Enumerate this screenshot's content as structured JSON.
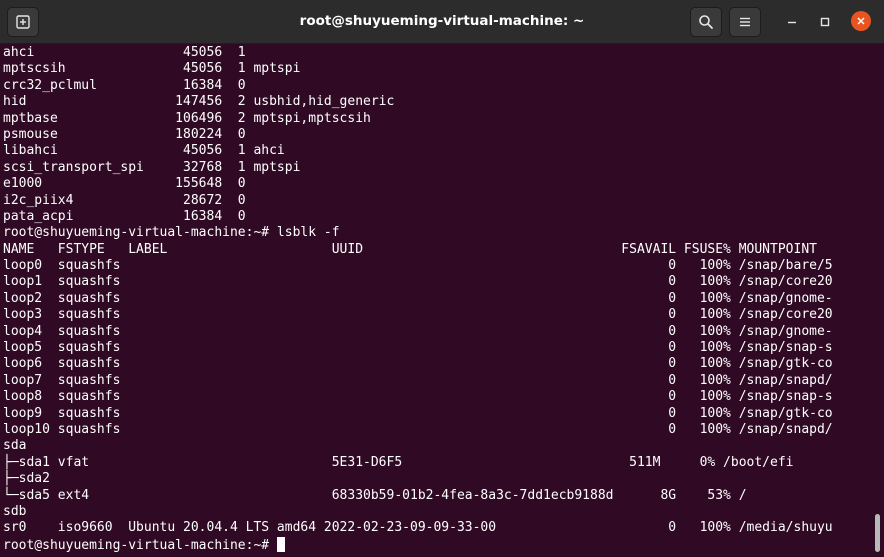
{
  "window": {
    "title": "root@shuyueming-virtual-machine: ~"
  },
  "icons": {
    "new_tab": "new-tab-icon",
    "search": "search-icon",
    "menu": "hamburger-menu-icon",
    "minimize": "minimize-icon",
    "maximize": "maximize-icon",
    "close": "close-icon"
  },
  "colors": {
    "terminal_background": "#300a24",
    "titlebar_background": "#2c2c2c",
    "close_button": "#e95420",
    "text": "#ffffff"
  },
  "terminal": {
    "lines": [
      "ahci                   45056  1",
      "mptscsih               45056  1 mptspi",
      "crc32_pclmul           16384  0",
      "hid                   147456  2 usbhid,hid_generic",
      "mptbase               106496  2 mptspi,mptscsih",
      "psmouse               180224  0",
      "libahci                45056  1 ahci",
      "scsi_transport_spi     32768  1 mptspi",
      "e1000                 155648  0",
      "i2c_piix4              28672  0",
      "pata_acpi              16384  0",
      "root@shuyueming-virtual-machine:~# lsblk -f",
      "NAME   FSTYPE   LABEL                     UUID                                 FSAVAIL FSUSE% MOUNTPOINT",
      "loop0  squashfs                                                                      0   100% /snap/bare/5",
      "loop1  squashfs                                                                      0   100% /snap/core20",
      "loop2  squashfs                                                                      0   100% /snap/gnome-",
      "loop3  squashfs                                                                      0   100% /snap/core20",
      "loop4  squashfs                                                                      0   100% /snap/gnome-",
      "loop5  squashfs                                                                      0   100% /snap/snap-s",
      "loop6  squashfs                                                                      0   100% /snap/gtk-co",
      "loop7  squashfs                                                                      0   100% /snap/snapd/",
      "loop8  squashfs                                                                      0   100% /snap/snap-s",
      "loop9  squashfs                                                                      0   100% /snap/gtk-co",
      "loop10 squashfs                                                                      0   100% /snap/snapd/",
      "sda",
      "├─sda1 vfat                               5E31-D6F5                             511M     0% /boot/efi",
      "├─sda2",
      "└─sda5 ext4                               68330b59-01b2-4fea-8a3c-7dd1ecb9188d      8G    53% /",
      "sdb",
      "sr0    iso9660  Ubuntu 20.04.4 LTS amd64 2022-02-23-09-09-33-00                      0   100% /media/shuyu"
    ],
    "prompt": "root@shuyueming-virtual-machine:~# "
  }
}
